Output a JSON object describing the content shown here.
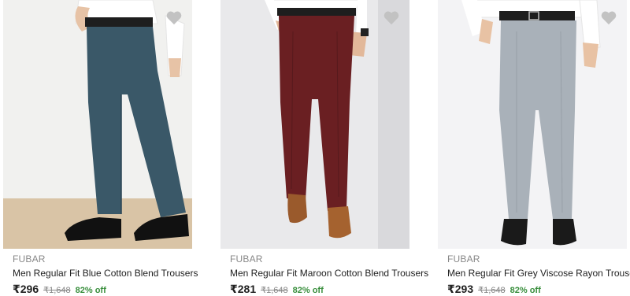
{
  "products": [
    {
      "brand": "FUBAR",
      "title": "Men Regular Fit Blue Cotton Blend Trousers",
      "price": "₹296",
      "mrp": "₹1,648",
      "discount": "82% off",
      "trouser_color": "#3a5868",
      "wishlist_icon": "heart-icon"
    },
    {
      "brand": "FUBAR",
      "title": "Men Regular Fit Maroon Cotton Blend Trousers",
      "price": "₹281",
      "mrp": "₹1,648",
      "discount": "82% off",
      "trouser_color": "#6a1f22",
      "wishlist_icon": "heart-icon"
    },
    {
      "brand": "FUBAR",
      "title": "Men Regular Fit Grey Viscose Rayon Trousers",
      "price": "₹293",
      "mrp": "₹1,648",
      "discount": "82% off",
      "trouser_color": "#a9b1b9",
      "wishlist_icon": "heart-icon"
    }
  ],
  "colors": {
    "discount": "#388e3c",
    "muted": "#878787",
    "text": "#212121"
  }
}
